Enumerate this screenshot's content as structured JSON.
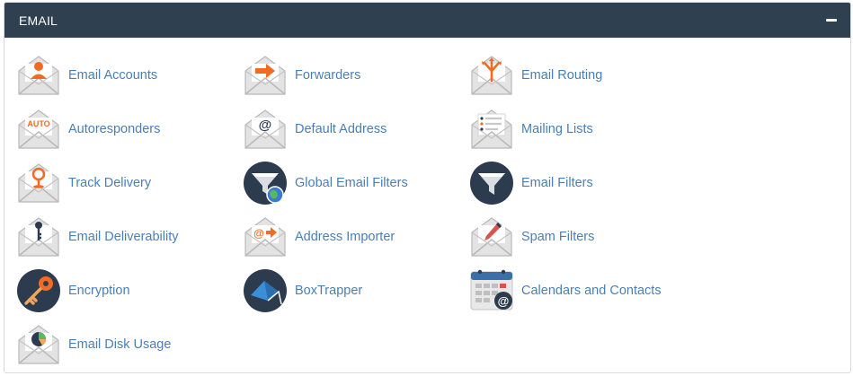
{
  "panel": {
    "title": "EMAIL",
    "collapse_icon": "minus-icon"
  },
  "colors": {
    "header_bg": "#2f4050",
    "link": "#4a7fb5",
    "accent_orange": "#f26b22",
    "dark_circle": "#2d3b4f"
  },
  "items": [
    {
      "label": "Email Accounts",
      "icon": "user-envelope-icon"
    },
    {
      "label": "Forwarders",
      "icon": "forward-arrow-envelope-icon"
    },
    {
      "label": "Email Routing",
      "icon": "routing-envelope-icon"
    },
    {
      "label": "Autoresponders",
      "icon": "auto-envelope-icon",
      "icon_text": "AUTO"
    },
    {
      "label": "Default Address",
      "icon": "at-sign-envelope-icon",
      "icon_text": "@"
    },
    {
      "label": "Mailing Lists",
      "icon": "list-envelope-icon"
    },
    {
      "label": "Track Delivery",
      "icon": "location-pin-envelope-icon"
    },
    {
      "label": "Global Email Filters",
      "icon": "globe-funnel-icon"
    },
    {
      "label": "Email Filters",
      "icon": "funnel-icon"
    },
    {
      "label": "Email Deliverability",
      "icon": "key-envelope-icon"
    },
    {
      "label": "Address Importer",
      "icon": "import-envelope-icon",
      "icon_text": "@"
    },
    {
      "label": "Spam Filters",
      "icon": "pen-envelope-icon"
    },
    {
      "label": "Encryption",
      "icon": "key-circle-icon"
    },
    {
      "label": "BoxTrapper",
      "icon": "box-trap-icon"
    },
    {
      "label": "Calendars and Contacts",
      "icon": "calendar-icon",
      "icon_text": "@"
    },
    {
      "label": "Email Disk Usage",
      "icon": "pie-chart-envelope-icon"
    }
  ]
}
